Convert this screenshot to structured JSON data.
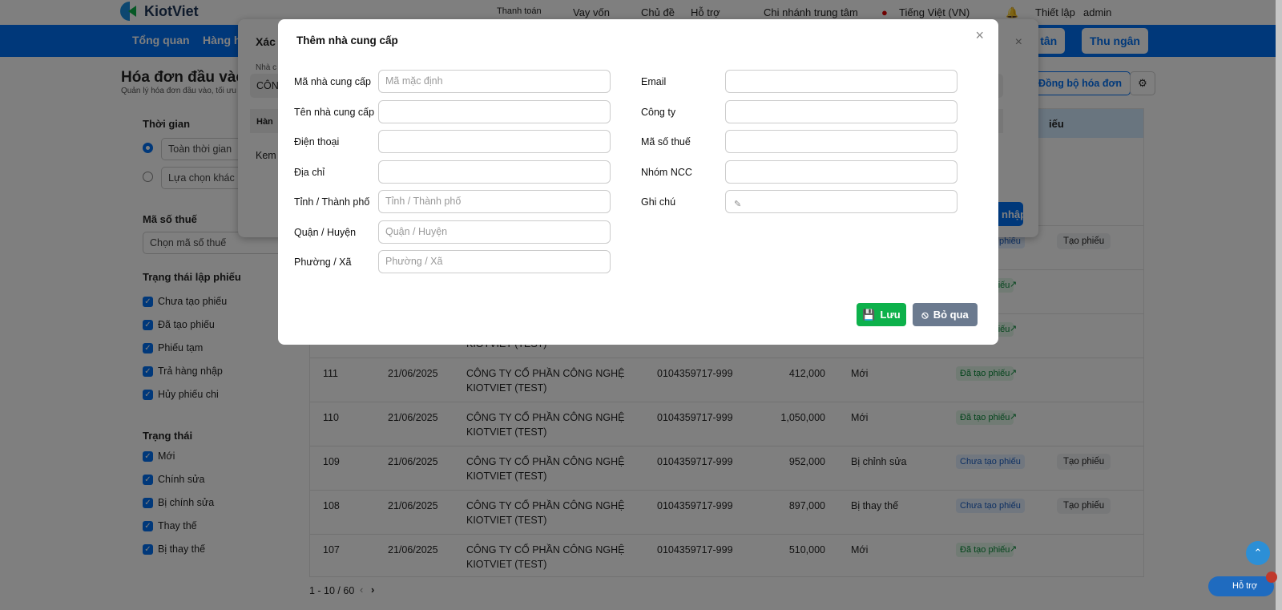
{
  "topbar": {
    "logo": "KiotViet",
    "items": [
      "Thanh toán",
      "Vay vốn",
      "Chủ đề",
      "Hỗ trợ",
      "Chi nhánh trung tâm",
      "Tiếng Việt (VN)",
      "Thiết lập",
      "admin"
    ]
  },
  "nav": {
    "items": [
      "Tổng quan",
      "Hàng hó"
    ],
    "reception": "Lễ tân",
    "cashier": "Thu ngân"
  },
  "page": {
    "title": "Hóa đơn đầu vào",
    "subtitle": "Quản lý hóa đơn đầu vào, tối ưu",
    "sync_button": "Đồng bộ hóa đơn"
  },
  "filters": {
    "time_title": "Thời gian",
    "time_all": "Toàn thời gian",
    "time_other": "Lựa chọn khác",
    "tax_title": "Mã số thuế",
    "tax_placeholder": "Chọn mã số thuế",
    "voucher_title": "Trạng thái lập phiếu",
    "voucher": [
      "Chưa tạo phiếu",
      "Đã tạo phiếu",
      "Phiếu tạm",
      "Trả hàng nhập",
      "Hủy phiếu chi"
    ],
    "status_title": "Trạng thái",
    "status": [
      "Mới",
      "Chính sửa",
      "Bị chính sửa",
      "Thay thế",
      "Bị thay thế"
    ]
  },
  "table": {
    "header_last": "iếu",
    "rows": [
      {
        "id": "",
        "date": "",
        "company1": "",
        "company2": "",
        "tax": "",
        "amount": "",
        "status": "",
        "badge": "Chưa tạo phiếu",
        "badge_type": "new",
        "action": "Tạo phiếu"
      },
      {
        "id": "",
        "date": "",
        "company1": "",
        "company2": "",
        "tax": "",
        "amount": "",
        "status": "",
        "badge": "Đã tạo phiếu",
        "badge_type": "done",
        "action": ""
      },
      {
        "id": "",
        "date": "",
        "company1": "",
        "company2": "KIOTVIET (TEST)",
        "tax": "",
        "amount": "",
        "status": "",
        "badge": "Đã tạo phiếu",
        "badge_type": "done",
        "action": ""
      },
      {
        "id": "111",
        "date": "21/06/2025",
        "company1": "CÔNG TY CỔ PHẦN CÔNG NGHỆ",
        "company2": "KIOTVIET (TEST)",
        "tax": "0104359717-999",
        "amount": "412,000",
        "status": "Mới",
        "badge": "Đã tạo phiếu",
        "badge_type": "done",
        "action": ""
      },
      {
        "id": "110",
        "date": "21/06/2025",
        "company1": "CÔNG TY CỔ PHẦN CÔNG NGHỆ",
        "company2": "KIOTVIET (TEST)",
        "tax": "0104359717-999",
        "amount": "1,050,000",
        "status": "Mới",
        "badge": "Đã tạo phiếu",
        "badge_type": "done",
        "action": ""
      },
      {
        "id": "109",
        "date": "21/06/2025",
        "company1": "CÔNG TY CỔ PHẦN CÔNG NGHỆ",
        "company2": "KIOTVIET (TEST)",
        "tax": "0104359717-999",
        "amount": "952,000",
        "status": "Bị chỉnh sửa",
        "badge": "Chưa tạo phiếu",
        "badge_type": "new",
        "action": "Tạo phiếu"
      },
      {
        "id": "108",
        "date": "21/06/2025",
        "company1": "CÔNG TY CỔ PHẦN CÔNG NGHỆ",
        "company2": "KIOTVIET (TEST)",
        "tax": "0104359717-999",
        "amount": "897,000",
        "status": "Bị thay thế",
        "badge": "Chưa tạo phiếu",
        "badge_type": "new",
        "action": "Tạo phiếu"
      },
      {
        "id": "107",
        "date": "21/06/2025",
        "company1": "CÔNG TY CỔ PHẦN CÔNG NGHỆ",
        "company2": "KIOTVIET (TEST)",
        "tax": "0104359717-999",
        "amount": "510,000",
        "status": "Mới",
        "badge": "Đã tạo phiếu",
        "badge_type": "done",
        "action": ""
      }
    ],
    "pagination": "1 - 10 / 60"
  },
  "bg_modal": {
    "title": "Xác",
    "field_label": "Nhà c",
    "field_value": "CÔN",
    "col_header": "Hàn",
    "row_text": "Kem",
    "confirm_button": "nhập"
  },
  "modal": {
    "title": "Thêm nhà cung cấp",
    "left": [
      {
        "label": "Mã nhà cung cấp",
        "placeholder": "Mã mặc định"
      },
      {
        "label": "Tên nhà cung cấp",
        "placeholder": ""
      },
      {
        "label": "Điện thoại",
        "placeholder": ""
      },
      {
        "label": "Địa chỉ",
        "placeholder": ""
      },
      {
        "label": "Tỉnh / Thành phố",
        "placeholder": "Tỉnh / Thành phố"
      },
      {
        "label": "Quận / Huyện",
        "placeholder": "Quận / Huyện"
      },
      {
        "label": "Phường / Xã",
        "placeholder": "Phường / Xã"
      }
    ],
    "right": [
      {
        "label": "Email",
        "placeholder": ""
      },
      {
        "label": "Công ty",
        "placeholder": ""
      },
      {
        "label": "Mã số thuế",
        "placeholder": ""
      },
      {
        "label": "Nhóm NCC",
        "placeholder": ""
      },
      {
        "label": "Ghi chú",
        "placeholder": ""
      }
    ],
    "save": "Lưu",
    "cancel": "Bỏ qua"
  },
  "support": "Hỗ trợ",
  "colors": {
    "primary": "#0070f4",
    "save": "#0db14b",
    "cancel": "#6b7a8f"
  }
}
